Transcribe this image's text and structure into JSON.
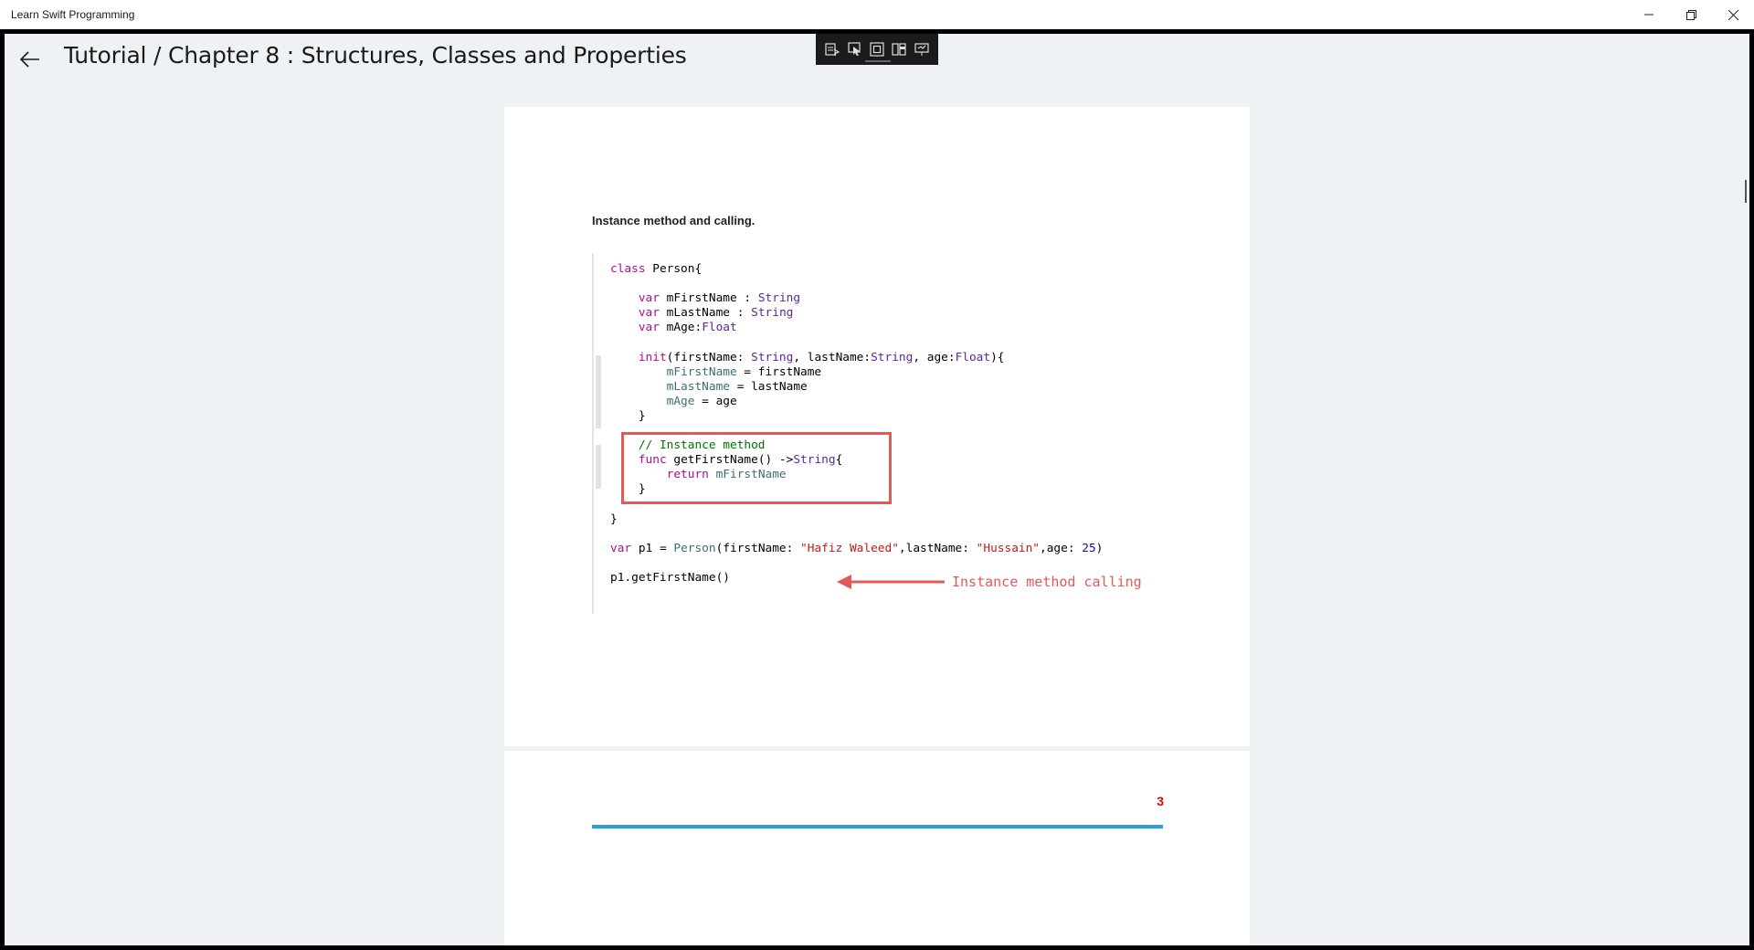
{
  "window": {
    "app_title": "Learn Swift Programming"
  },
  "header": {
    "title": "Tutorial / Chapter 8 :  Structures, Classes and Properties"
  },
  "toolbar": {
    "icons": [
      "select-text-icon",
      "pointer-icon",
      "fit-page-icon",
      "two-page-icon",
      "presentation-icon"
    ]
  },
  "document": {
    "section_heading": "Instance method and calling.",
    "code": {
      "lines": [
        "class Person{",
        "",
        "    var mFirstName : String",
        "    var mLastName : String",
        "    var mAge:Float",
        "",
        "    init(firstName: String, lastName:String, age:Float){",
        "        mFirstName = firstName",
        "        mLastName = lastName",
        "        mAge = age",
        "    }",
        "",
        "    // Instance method",
        "    func getFirstName() ->String{",
        "        return mFirstName",
        "    }",
        "",
        "}",
        "",
        "var p1 = Person(firstName: \"Hafiz Waleed\",lastName: \"Hussain\",age: 25)",
        "",
        "p1.getFirstName()"
      ],
      "annotation_label": "Instance method calling"
    },
    "page_number": "3"
  },
  "colors": {
    "accent_rule": "#2a9fe0",
    "highlight_box": "#e05a58",
    "page_number": "#e00000"
  }
}
